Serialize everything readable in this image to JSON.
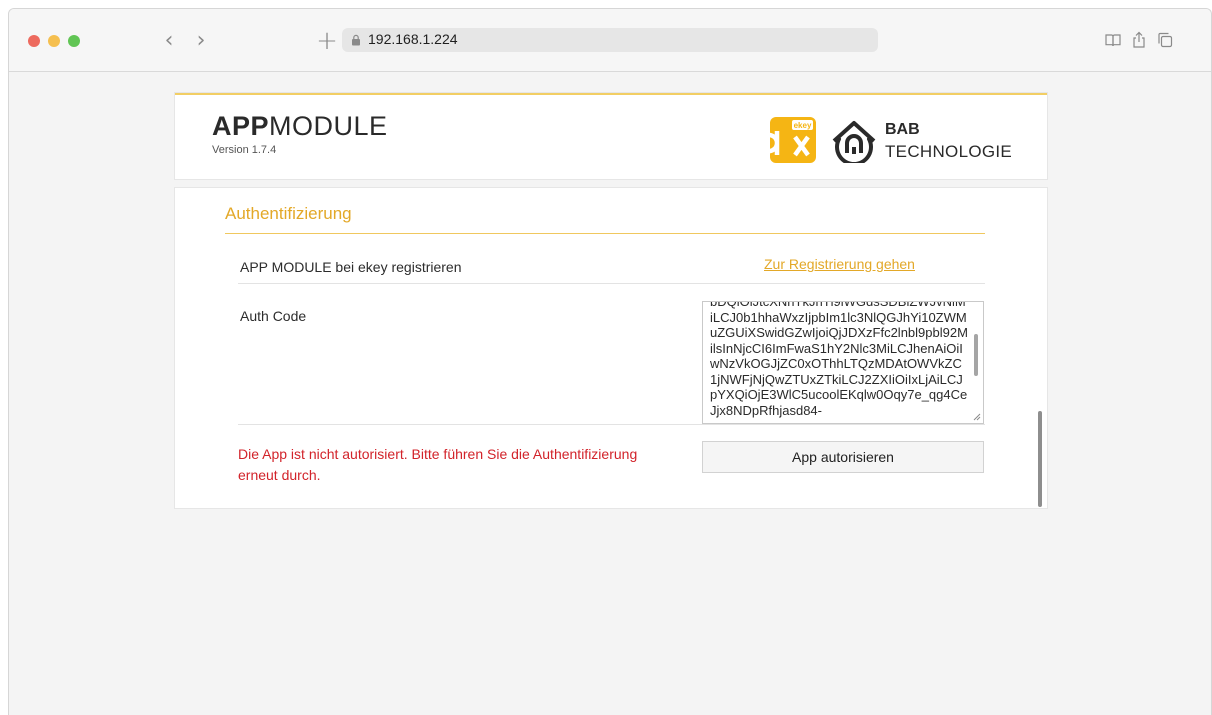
{
  "browser": {
    "url": "192.168.1.224"
  },
  "header": {
    "title_bold": "APP",
    "title_light": "MODULE",
    "version": "Version 1.7.4",
    "ekey_label": "ekey",
    "bab_line1": "BAB",
    "bab_line2": "TECHNOLOGIE"
  },
  "auth_section": {
    "title": "Authentifizierung",
    "register_label": "APP MODULE bei ekey registrieren",
    "register_link": "Zur Registrierung gehen",
    "auth_code_label": "Auth Code",
    "auth_code_value": "bDQiOiJtcXNhTkJhTl9iWGdsSDBiZWJvNlMiLCJ0b1hhaWxzIjpbIm1lc3NlQGJhYi10ZWMuZGUiXSwidGZwIjoiQjJDXzFfc2lnbl9pbl92MilsInNjcCI6ImFwaS1hY2Nlc3MiLCJhenAiOiIwNzVkOGJjZC0xOThhLTQzMDAtOWVkZC1jNWFjNjQwZTUxZTkiLCJ2ZXIiOiIxLjAiLCJpYXQiOjE3WlC5ucoolEKqlw0Oqy7e_qg4CeJjx8NDpRfhjasd84-",
    "error_message": "Die App ist nicht autorisiert. Bitte führen Sie die Authentifizierung erneut durch.",
    "authorize_button": "App autorisieren"
  },
  "colors": {
    "accent": "#e3a828",
    "error": "#d2232a",
    "ekey_brand": "#f5b514"
  }
}
